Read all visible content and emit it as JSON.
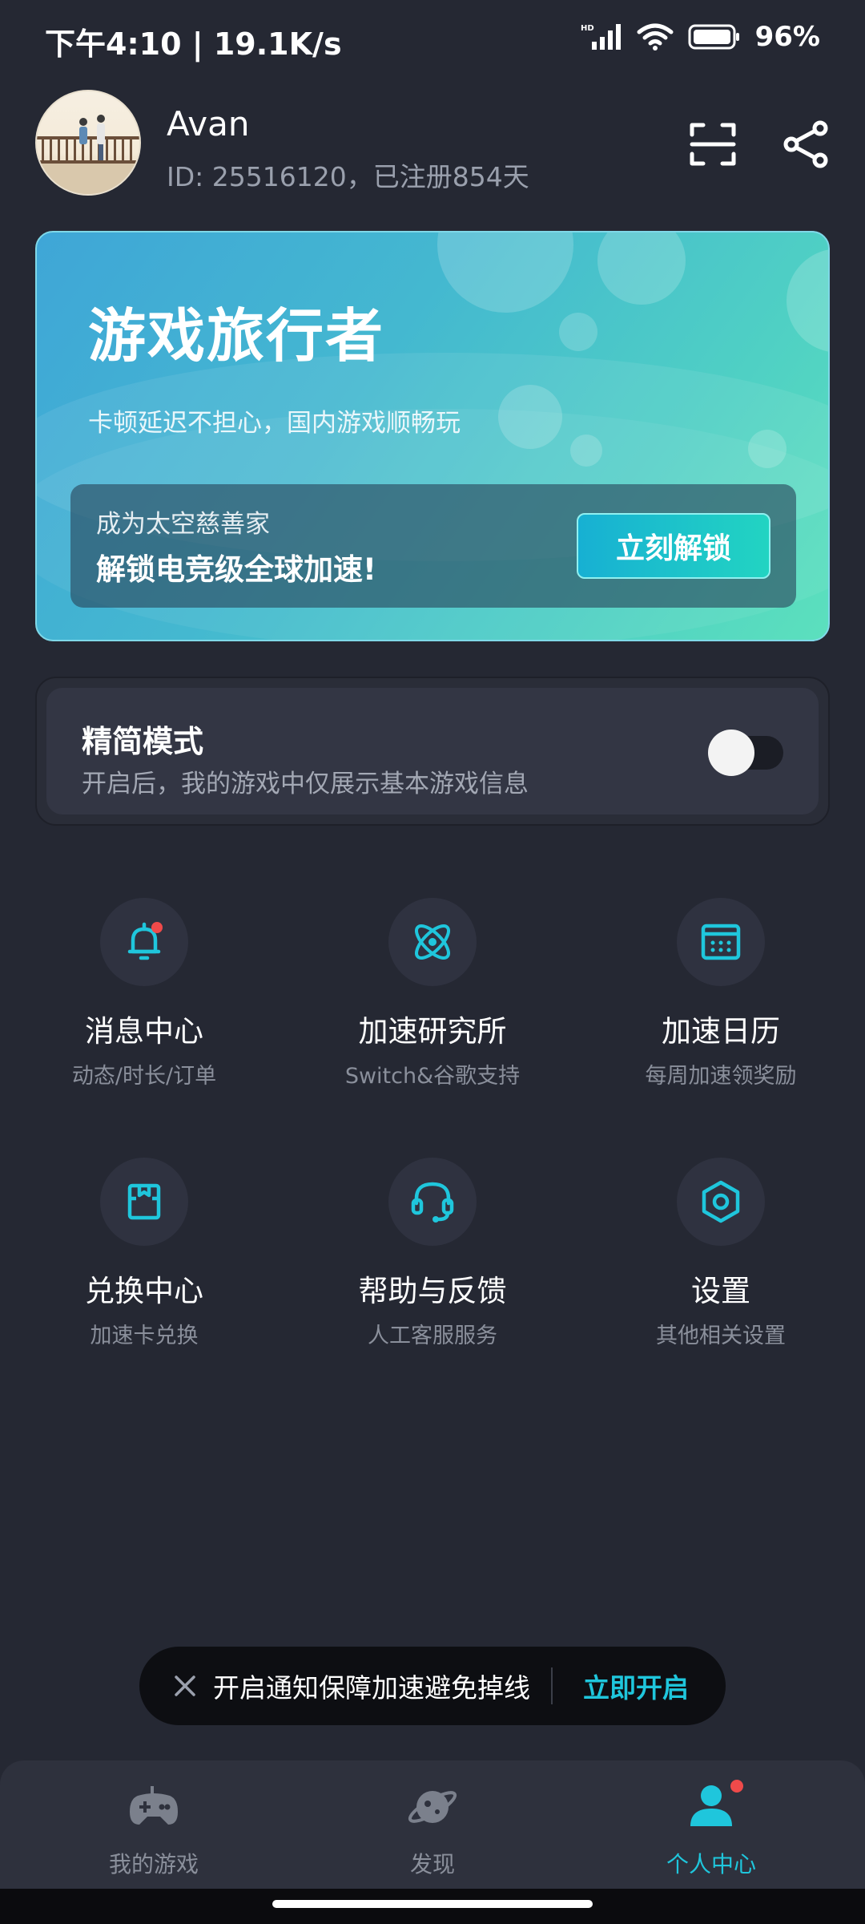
{
  "status_bar": {
    "time": "下午4:10 | 19.1K/s",
    "network_badge": "HD",
    "battery": "96%"
  },
  "profile": {
    "username": "Avan",
    "id_text": "ID: 25516120，已注册854天"
  },
  "header_icons": [
    "scan-icon",
    "share-icon"
  ],
  "banner": {
    "title": "游戏旅行者",
    "subtitle": "卡顿延迟不担心，国内游戏顺畅玩",
    "promo_line1": "成为太空慈善家",
    "promo_line2": "解锁电竞级全球加速!",
    "button": "立刻解锁"
  },
  "simple_mode": {
    "title": "精简模式",
    "description": "开启后，我的游戏中仅展示基本游戏信息",
    "enabled": false
  },
  "grid": [
    {
      "title": "消息中心",
      "subtitle": "动态/时长/订单",
      "icon": "bell-icon"
    },
    {
      "title": "加速研究所",
      "subtitle": "Switch&谷歌支持",
      "icon": "atom-icon"
    },
    {
      "title": "加速日历",
      "subtitle": "每周加速领奖励",
      "icon": "calendar-icon"
    },
    {
      "title": "兑换中心",
      "subtitle": "加速卡兑换",
      "icon": "gift-box-icon"
    },
    {
      "title": "帮助与反馈",
      "subtitle": "人工客服服务",
      "icon": "headset-icon"
    },
    {
      "title": "设置",
      "subtitle": "其他相关设置",
      "icon": "settings-icon"
    }
  ],
  "toast": {
    "text": "开启通知保障加速避免掉线",
    "action": "立即开启"
  },
  "bottom_nav": [
    {
      "label": "我的游戏",
      "icon": "gamepad-icon",
      "active": false
    },
    {
      "label": "发现",
      "icon": "planet-icon",
      "active": false
    },
    {
      "label": "个人中心",
      "icon": "user-icon",
      "active": true
    }
  ],
  "colors": {
    "background": "#252833",
    "accent": "#1fc6dc",
    "notification_dot": "#ef4a4a"
  }
}
